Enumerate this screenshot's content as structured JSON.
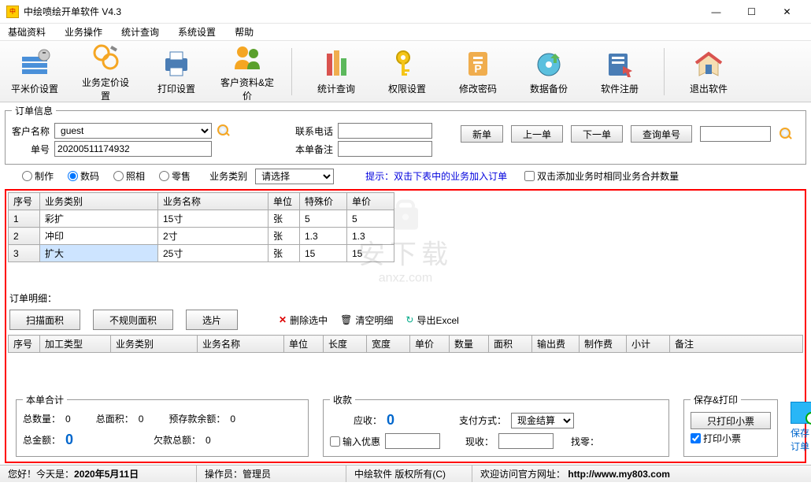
{
  "window": {
    "title": "中绘喷绘开单软件 V4.3"
  },
  "menu": [
    "基础资料",
    "业务操作",
    "统计查询",
    "系统设置",
    "帮助"
  ],
  "toolbar": [
    {
      "label": "平米价设置",
      "icon": "sqm-price-icon"
    },
    {
      "label": "业务定价设置",
      "icon": "pricing-icon"
    },
    {
      "label": "打印设置",
      "icon": "printer-icon"
    },
    {
      "label": "客户资料&定价",
      "icon": "customer-icon"
    },
    {
      "label": "统计查询",
      "icon": "stats-icon"
    },
    {
      "label": "权限设置",
      "icon": "permission-icon"
    },
    {
      "label": "修改密码",
      "icon": "password-icon"
    },
    {
      "label": "数据备份",
      "icon": "backup-icon"
    },
    {
      "label": "软件注册",
      "icon": "register-icon"
    },
    {
      "label": "退出软件",
      "icon": "exit-icon"
    }
  ],
  "orderinfo": {
    "legend": "订单信息",
    "customer_label": "客户名称",
    "customer_value": "guest",
    "orderno_label": "单号",
    "orderno_value": "20200511174932",
    "phone_label": "联系电话",
    "phone_value": "",
    "note_label": "本单备注",
    "note_value": "",
    "btn_new": "新单",
    "btn_prev": "上一单",
    "btn_next": "下一单",
    "btn_search": "查询单号",
    "search_value": ""
  },
  "radios": {
    "r1": "制作",
    "r2": "数码",
    "r3": "照相",
    "r4": "零售",
    "biztype_label": "业务类别",
    "biztype_value": "请选择",
    "hint": "提示：双击下表中的业务加入订单",
    "merge_label": "双击添加业务时相同业务合并数量"
  },
  "table1": {
    "headers": [
      "序号",
      "业务类别",
      "业务名称",
      "单位",
      "特殊价",
      "单价"
    ],
    "rows": [
      {
        "no": "1",
        "cat": "彩扩",
        "name": "15寸",
        "unit": "张",
        "sp": "5",
        "price": "5"
      },
      {
        "no": "2",
        "cat": "冲印",
        "name": "2寸",
        "unit": "张",
        "sp": "1.3",
        "price": "1.3"
      },
      {
        "no": "3",
        "cat": "扩大",
        "name": "25寸",
        "unit": "张",
        "sp": "15",
        "price": "15"
      }
    ]
  },
  "detail": {
    "label": "订单明细：",
    "btn_scan": "扫描面积",
    "btn_irreg": "不规则面积",
    "btn_select": "选片",
    "del_sel": "删除选中",
    "clear": "清空明细",
    "export": "导出Excel"
  },
  "table2": {
    "headers": [
      "序号",
      "加工类型",
      "业务类别",
      "业务名称",
      "单位",
      "长度",
      "宽度",
      "单价",
      "数量",
      "面积",
      "输出费",
      "制作费",
      "小计",
      "备注"
    ]
  },
  "totals": {
    "legend": "本单合计",
    "qty_label": "总数量：",
    "qty": "0",
    "area_label": "总面积：",
    "area": "0",
    "prepaid_label": "预存款余额：",
    "prepaid": "0",
    "amount_label": "总金额：",
    "amount": "0",
    "debt_label": "欠款总额：",
    "debt": "0"
  },
  "pay": {
    "legend": "收款",
    "due_label": "应收：",
    "due": "0",
    "method_label": "支付方式：",
    "method": "现金结算",
    "discount_label": "输入优惠",
    "discount_value": "",
    "received_label": "现收：",
    "received_value": "",
    "change_label": "找零："
  },
  "saveprint": {
    "legend": "保存&打印",
    "btn_print": "只打印小票",
    "chk_print": "打印小票",
    "save_label": "保存订单"
  },
  "status": {
    "today_label": "您好！今天是：",
    "today": "2020年5月11日",
    "operator_label": "操作员：",
    "operator": "管理员",
    "copyright": "中绘软件 版权所有(C)",
    "visit": "欢迎访问官方网址：",
    "url": "http://www.my803.com"
  },
  "watermark": {
    "line1": "安下载",
    "line2": "anxz.com"
  }
}
